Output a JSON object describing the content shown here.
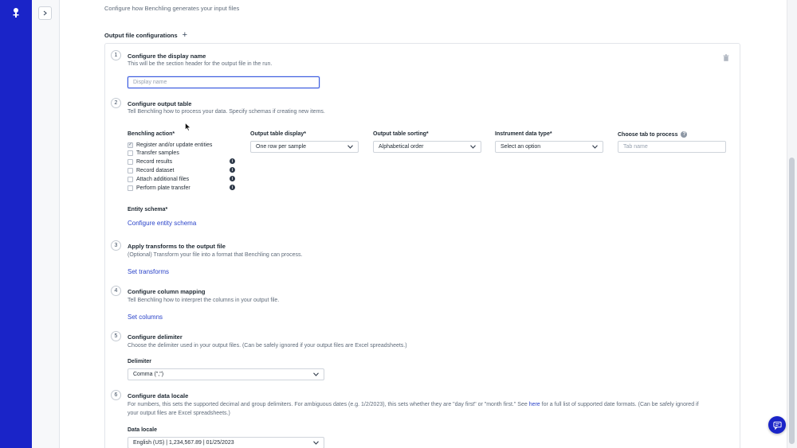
{
  "header": {
    "intro": "Configure how Benchling generates your input files",
    "section_title": "Output file configurations"
  },
  "steps": {
    "s1": {
      "number": "1",
      "title": "Configure the display name",
      "desc": "This will be the section header for the output file in the run.",
      "input_placeholder": "Display name"
    },
    "s2": {
      "number": "2",
      "title": "Configure output table",
      "desc": "Tell Benchling how to process your data. Specify schemas if creating new items.",
      "benchling_action_label": "Benchling action*",
      "actions": [
        {
          "label": "Register and/or update entities",
          "checked": true,
          "info": false
        },
        {
          "label": "Transfer samples",
          "checked": false,
          "info": false
        },
        {
          "label": "Record results",
          "checked": false,
          "info": true
        },
        {
          "label": "Record dataset",
          "checked": false,
          "info": true
        },
        {
          "label": "Attach additional files",
          "checked": false,
          "info": true
        },
        {
          "label": "Perform plate transfer",
          "checked": false,
          "info": true
        }
      ],
      "display_label": "Output table display*",
      "display_value": "One row per sample",
      "sorting_label": "Output table sorting*",
      "sorting_value": "Alphabetical order",
      "instrument_label": "Instrument data type*",
      "instrument_value": "Select an option",
      "tab_label": "Choose tab to process",
      "tab_placeholder": "Tab name",
      "entity_schema_label": "Entity schema*",
      "entity_schema_link": "Configure entity schema"
    },
    "s3": {
      "number": "3",
      "title": "Apply transforms to the output file",
      "desc": "(Optional) Transform your file into a format that Benchling can process.",
      "link": "Set transforms"
    },
    "s4": {
      "number": "4",
      "title": "Configure column mapping",
      "desc": "Tell Benchling how to interpret the columns in your output file.",
      "link": "Set columns"
    },
    "s5": {
      "number": "5",
      "title": "Configure delimiter",
      "desc": "Choose the delimiter used in your output files. (Can be safely ignored if your output files are Excel spreadsheets.)",
      "field_label": "Delimiter",
      "value": "Comma (\",\")"
    },
    "s6": {
      "number": "6",
      "title": "Configure data locale",
      "desc_line1_pre": "For numbers, this sets the supported decimal and group delimiters. For ambiguous dates (e.g. 1/2/2023), this sets whether they are \"day first\" or \"month first.\" See ",
      "desc_line1_link": "here",
      "desc_line1_post": " for a full list of supported date formats. (Can be safely ignored if",
      "desc_line2": "your output files are Excel spreadsheets.)",
      "field_label": "Data locale",
      "value": "English (US) | 1,234,567.89 | 01/25/2023"
    }
  },
  "icons": {
    "logo": "benchling-logo-icon",
    "expand": "chevron-right-icon",
    "add": "plus-icon",
    "delete": "trash-icon",
    "help": "question-circle-icon",
    "info": "info-circle-icon",
    "chat": "chat-icon"
  },
  "colors": {
    "nav_rail": "#1a24c8",
    "link": "#2a43c9",
    "focus": "#3b5bdb"
  }
}
